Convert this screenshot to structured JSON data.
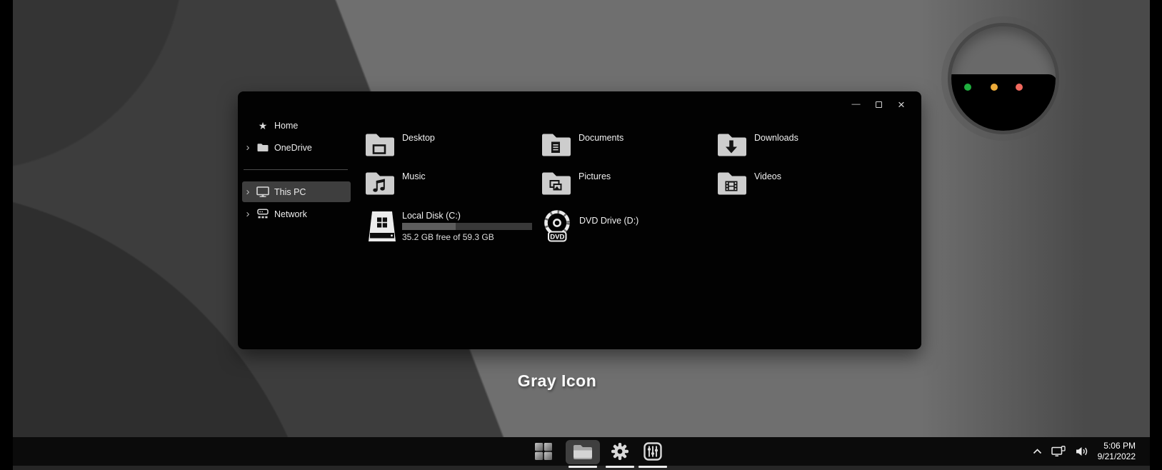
{
  "desktop": {
    "watermark": "Gray Icon"
  },
  "magnifier": {
    "dots": [
      "#1fae3e",
      "#ecab3a",
      "#f1695e"
    ]
  },
  "window": {
    "controls": {
      "minimize_glyph": "—",
      "close_glyph": "×"
    },
    "sidebar": {
      "chevron_glyph": "›",
      "home_glyph": "★",
      "items": [
        {
          "label": "Home"
        },
        {
          "label": "OneDrive"
        },
        {
          "label": "This PC"
        },
        {
          "label": "Network"
        }
      ]
    },
    "folders": [
      {
        "label": "Desktop"
      },
      {
        "label": "Documents"
      },
      {
        "label": "Downloads"
      },
      {
        "label": "Music"
      },
      {
        "label": "Pictures"
      },
      {
        "label": "Videos"
      }
    ],
    "drives": {
      "local": {
        "label": "Local Disk (C:)",
        "free": "35.2 GB free of 59.3 GB",
        "used_percent": 41
      },
      "dvd": {
        "label": "DVD Drive (D:)",
        "badge": "DVD"
      }
    }
  },
  "tray": {
    "time": "5:06 PM",
    "date": "9/21/2022"
  }
}
